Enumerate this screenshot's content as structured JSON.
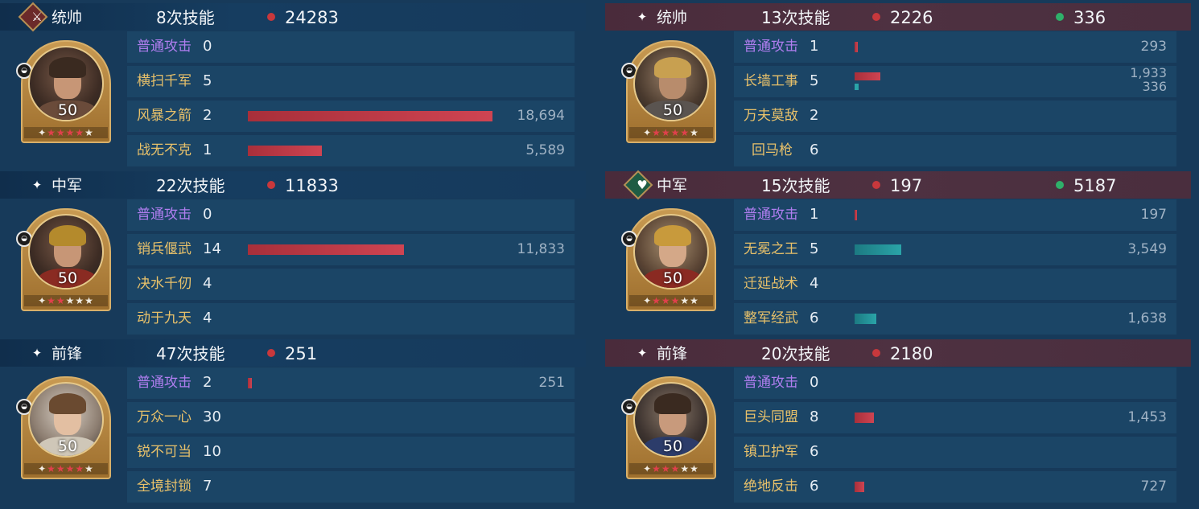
{
  "left": {
    "sections": [
      {
        "role": "统帅",
        "role_icon": "sword-icon",
        "skill_count": "8次技能",
        "damage": "24283",
        "level": "50",
        "stars_red": 4,
        "stars_total": 5,
        "skills": [
          {
            "name": "普通攻击",
            "level": "0",
            "type": "basic",
            "value": ""
          },
          {
            "name": "横扫千军",
            "level": "5",
            "type": "active",
            "value": ""
          },
          {
            "name": "风暴之箭",
            "level": "2",
            "type": "active",
            "value": "18,694"
          },
          {
            "name": "战无不克",
            "level": "1",
            "type": "active",
            "value": "5,589"
          }
        ]
      },
      {
        "role": "中军",
        "role_icon": "sparkle-icon",
        "skill_count": "22次技能",
        "damage": "11833",
        "level": "50",
        "stars_red": 2,
        "stars_total": 5,
        "skills": [
          {
            "name": "普通攻击",
            "level": "0",
            "type": "basic",
            "value": ""
          },
          {
            "name": "销兵偃武",
            "level": "14",
            "type": "active",
            "value": "11,833"
          },
          {
            "name": "决水千仞",
            "level": "4",
            "type": "active",
            "value": ""
          },
          {
            "name": "动于九天",
            "level": "4",
            "type": "active",
            "value": ""
          }
        ]
      },
      {
        "role": "前锋",
        "role_icon": "sparkle-icon",
        "skill_count": "47次技能",
        "damage": "251",
        "level": "50",
        "stars_red": 4,
        "stars_total": 5,
        "skills": [
          {
            "name": "普通攻击",
            "level": "2",
            "type": "basic",
            "value": "251"
          },
          {
            "name": "万众一心",
            "level": "30",
            "type": "active",
            "value": ""
          },
          {
            "name": "锐不可当",
            "level": "10",
            "type": "active",
            "value": ""
          },
          {
            "name": "全境封锁",
            "level": "7",
            "type": "active",
            "value": ""
          }
        ]
      }
    ]
  },
  "right": {
    "sections": [
      {
        "role": "统帅",
        "role_icon": "sparkle-icon",
        "skill_count": "13次技能",
        "damage": "2226",
        "heal": "336",
        "level": "50",
        "stars_red": 4,
        "stars_total": 5,
        "skills": [
          {
            "name": "普通攻击",
            "level": "1",
            "type": "basic",
            "value": "293"
          },
          {
            "name": "长墙工事",
            "level": "5",
            "type": "active",
            "value": "1,933",
            "value2": "336"
          },
          {
            "name": "万夫莫敌",
            "level": "2",
            "type": "active",
            "value": ""
          },
          {
            "name": "回马枪",
            "level": "6",
            "type": "active",
            "value": ""
          }
        ]
      },
      {
        "role": "中军",
        "role_icon": "heart-icon",
        "skill_count": "15次技能",
        "damage": "197",
        "heal": "5187",
        "level": "50",
        "stars_red": 3,
        "stars_total": 5,
        "skills": [
          {
            "name": "普通攻击",
            "level": "1",
            "type": "basic",
            "value": "197"
          },
          {
            "name": "无冕之王",
            "level": "5",
            "type": "active",
            "value": "3,549"
          },
          {
            "name": "迁延战术",
            "level": "4",
            "type": "active",
            "value": ""
          },
          {
            "name": "整军经武",
            "level": "6",
            "type": "active",
            "value": "1,638"
          }
        ]
      },
      {
        "role": "前锋",
        "role_icon": "sparkle-icon",
        "skill_count": "20次技能",
        "damage": "2180",
        "level": "50",
        "stars_red": 3,
        "stars_total": 5,
        "skills": [
          {
            "name": "普通攻击",
            "level": "0",
            "type": "basic",
            "value": ""
          },
          {
            "name": "巨头同盟",
            "level": "8",
            "type": "active",
            "value": "1,453"
          },
          {
            "name": "镇卫护军",
            "level": "6",
            "type": "active",
            "value": ""
          },
          {
            "name": "绝地反击",
            "level": "6",
            "type": "active",
            "value": "727"
          }
        ]
      }
    ]
  },
  "colors": {
    "background": "#173a5a",
    "damage_bar": "#c83a48",
    "heal_bar": "#2aa4a8",
    "basic_skill": "#b07ef0",
    "skill_name": "#e8c16a"
  }
}
